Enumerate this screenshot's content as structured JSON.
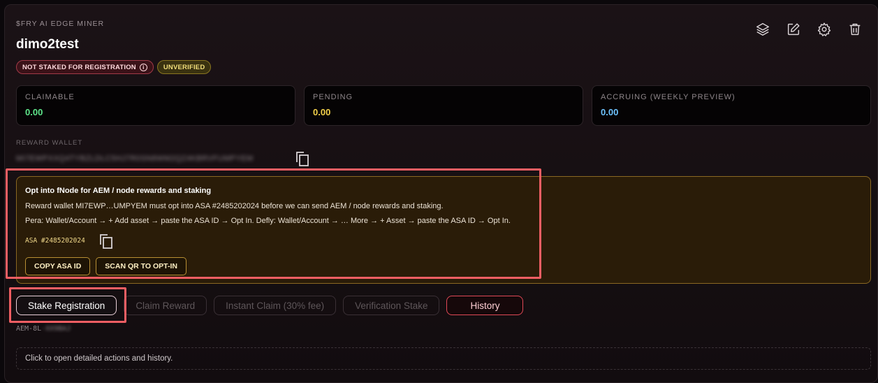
{
  "header": {
    "eyebrow": "$FRY AI EDGE MINER",
    "title": "dimo2test",
    "badges": {
      "stake_status": "NOT STAKED FOR REGISTRATION",
      "verification": "UNVERIFIED"
    },
    "icons": [
      "layers-icon",
      "edit-icon",
      "gear-icon",
      "trash-icon"
    ]
  },
  "stats": [
    {
      "label": "CLAIMABLE",
      "value": "0.00",
      "color": "#5ee58a"
    },
    {
      "label": "PENDING",
      "value": "0.00",
      "color": "#f2d04a"
    },
    {
      "label": "ACCRUING (WEEKLY PREVIEW)",
      "value": "0.00",
      "color": "#6ec3ff"
    }
  ],
  "reward_wallet": {
    "label": "REWARD WALLET",
    "address": "MI7EWPXXQ4TYBZLDLC5HJ7R0SN8WM2QZ4KBRVFUMPYEM"
  },
  "opt_in": {
    "title": "Opt into fNode for AEM / node rewards and staking",
    "line1": "Reward wallet MI7EWP…UMPYEM must opt into ASA #2485202024 before we can send AEM / node rewards and staking.",
    "line2": "Pera: Wallet/Account → + Add asset → paste the ASA ID → Opt In. Defly: Wallet/Account → … More → + Asset → paste the ASA ID → Opt In.",
    "asa_label": "ASA #2485202024",
    "copy_button": "COPY ASA ID",
    "qr_button": "SCAN QR TO OPT-IN"
  },
  "actions": {
    "stake_registration": "Stake Registration",
    "claim_reward": "Claim Reward",
    "instant_claim": "Instant Claim (30% fee)",
    "verification_stake": "Verification Stake",
    "history": "History"
  },
  "aem": {
    "prefix": "AEM-8L",
    "suffix": "·XX9BAJ"
  },
  "details": {
    "hint": "Click to open detailed actions and history."
  },
  "colors": {
    "highlight": "#f05e63",
    "opt_border": "#8a6822",
    "history_border": "#e04856"
  }
}
